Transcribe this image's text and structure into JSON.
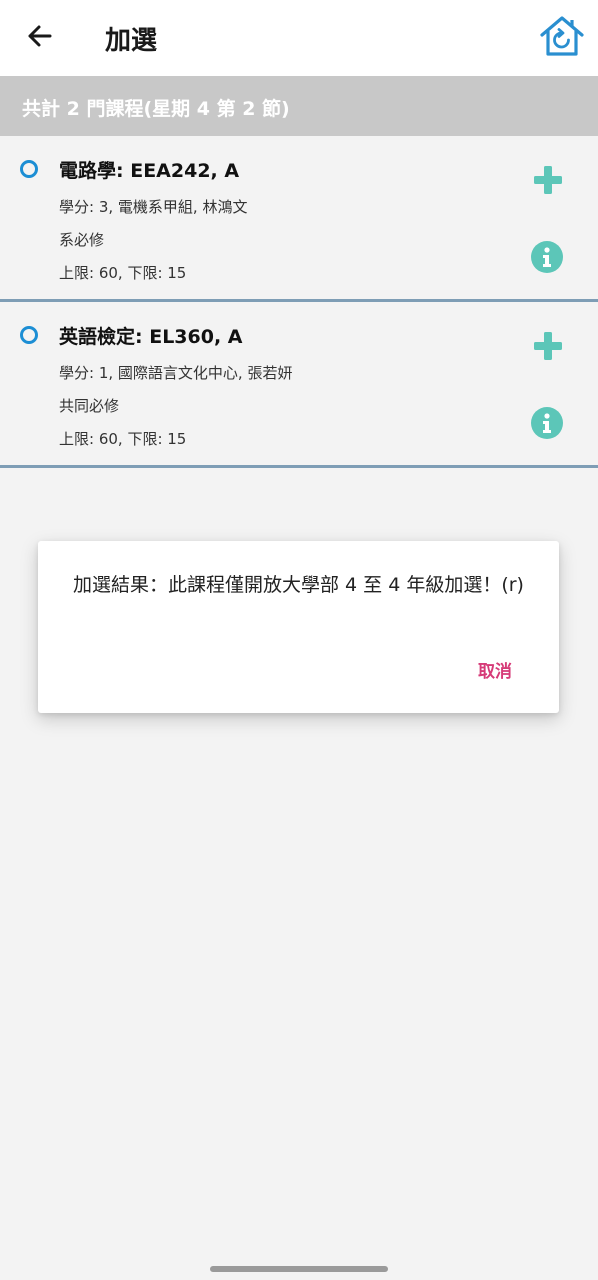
{
  "header": {
    "title": "加選",
    "back_icon": "arrow-left-icon",
    "home_icon": "home-refresh-icon"
  },
  "summary": {
    "text": "共計 2 門課程(星期 4 第 2 節)"
  },
  "courses": [
    {
      "name": "電路學: EEA242, A",
      "detail": "學分: 3, 電機系甲組, 林鴻文",
      "category": "系必修",
      "limits": "上限: 60, 下限: 15"
    },
    {
      "name": "英語檢定: EL360, A",
      "detail": "學分: 1, 國際語言文化中心, 張若妍",
      "category": "共同必修",
      "limits": "上限: 60, 下限: 15"
    }
  ],
  "dialog": {
    "message": "加選結果：此課程僅開放大學部 4 至 4 年級加選！(r)",
    "cancel_label": "取消"
  },
  "colors": {
    "accent_teal": "#5cc6b8",
    "radio_blue": "#1c8ed4",
    "cancel_pink": "#d63b78",
    "divider": "#7e9db5",
    "summary_bg": "#c8c8c8",
    "home_blue": "#2a8fd0"
  }
}
